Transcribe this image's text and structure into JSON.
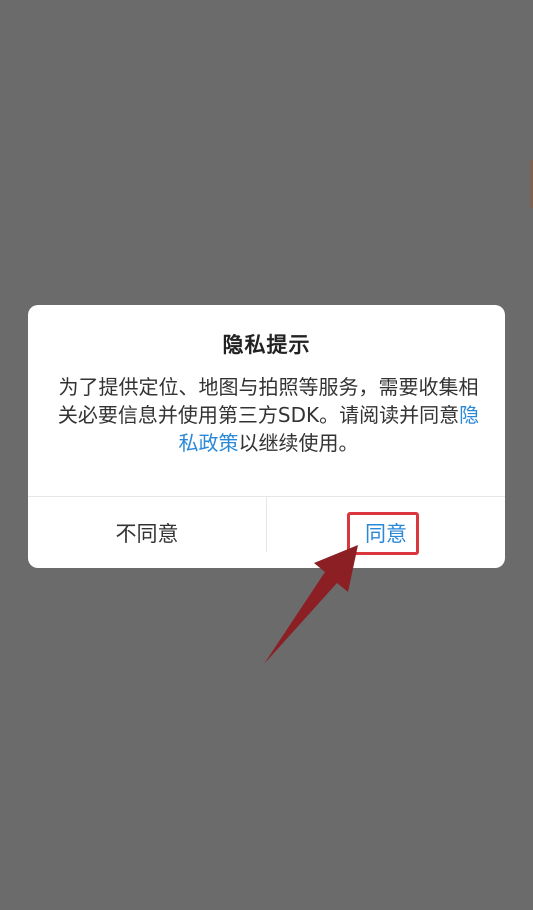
{
  "dialog": {
    "title": "隐私提示",
    "message_before": "为了提供定位、地图与拍照等服务，需要收集相关必要信息并使用第三方SDK。请阅读并同意",
    "privacy_link": "隐私政策",
    "message_after": "以继续使用。",
    "disagree_label": "不同意",
    "agree_label": "同意"
  },
  "colors": {
    "backdrop": "#6b6b6b",
    "link": "#2a88d8",
    "highlight": "#d9363e",
    "arrow": "#8b1f24"
  }
}
